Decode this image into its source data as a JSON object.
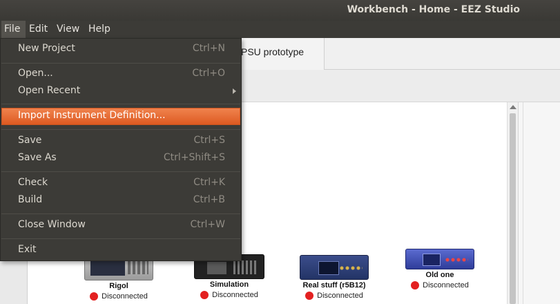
{
  "window": {
    "title": "Workbench - Home - EEZ Studio"
  },
  "menubar": [
    "File",
    "Edit",
    "View",
    "Help"
  ],
  "file_menu": {
    "items": [
      {
        "label": "New Project",
        "shortcut": "Ctrl+N"
      },
      {
        "label": "Open...",
        "shortcut": "Ctrl+O"
      },
      {
        "label": "Open Recent",
        "shortcut": ""
      },
      {
        "label": "Import Instrument Definition...",
        "shortcut": ""
      },
      {
        "label": "Save",
        "shortcut": "Ctrl+S"
      },
      {
        "label": "Save As",
        "shortcut": "Ctrl+Shift+S"
      },
      {
        "label": "Check",
        "shortcut": "Ctrl+K"
      },
      {
        "label": "Build",
        "shortcut": "Ctrl+B"
      },
      {
        "label": "Close Window",
        "shortcut": "Ctrl+W"
      },
      {
        "label": "Exit",
        "shortcut": ""
      }
    ],
    "highlight_color": "#e9682f"
  },
  "tabs": [
    {
      "label": "PSU prototype"
    }
  ],
  "instruments": [
    {
      "name": "Rigol",
      "status": "Disconnected"
    },
    {
      "name": "Simulation",
      "status": "Disconnected"
    },
    {
      "name": "Real stuff (r5B12)",
      "status": "Disconnected"
    },
    {
      "name": "Old one",
      "status": "Disconnected"
    }
  ],
  "colors": {
    "status_disconnected": "#e32020",
    "menu_bg": "#3c3b37"
  }
}
